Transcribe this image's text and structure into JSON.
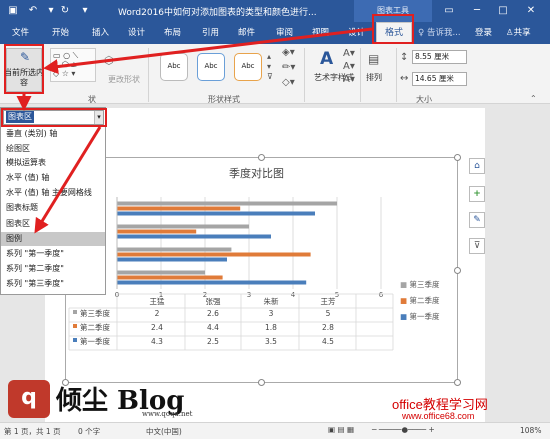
{
  "window": {
    "title": "Word2016中如何对添加图表的类型和颜色进行...",
    "context_tab": "图表工具",
    "user": "登录",
    "share": "共享",
    "tell_me": "告诉我..."
  },
  "tabs": [
    "文件",
    "开始",
    "插入",
    "设计",
    "布局",
    "引用",
    "邮件",
    "审阅",
    "视图",
    "设计",
    "格式"
  ],
  "ribbon": {
    "current_selection_label": "当前所选内容",
    "change_shape": "更改形状",
    "shape_style_label": "形状样式",
    "shapes_label": "状",
    "swatch_text": "Abc",
    "art_text": "艺术字样式",
    "arrange": "排列",
    "size_label": "大小",
    "height": "8.55 厘米",
    "width": "14.65 厘米"
  },
  "dropdown": {
    "selected": "图表区",
    "items": [
      "垂直 (类别) 轴",
      "绘图区",
      "模拟运算表",
      "水平 (值) 轴",
      "水平 (值) 轴 主要网格线",
      "图表标题",
      "图表区",
      "图例",
      "系列 \"第一季度\"",
      "系列 \"第二季度\"",
      "系列 \"第三季度\""
    ],
    "highlighted": "图例"
  },
  "chart_data": {
    "type": "bar",
    "title": "季度对比图",
    "categories": [
      "王猛",
      "张强",
      "朱新",
      "王芳"
    ],
    "series": [
      {
        "name": "第一季度",
        "values": [
          4.3,
          2.5,
          3.5,
          4.5
        ],
        "color": "#4a7ebb"
      },
      {
        "name": "第二季度",
        "values": [
          2.4,
          4.4,
          1.8,
          2.8
        ],
        "color": "#e07b39"
      },
      {
        "name": "第三季度",
        "values": [
          2,
          2.6,
          3,
          5
        ],
        "color": "#a5a5a5"
      }
    ],
    "xlim": [
      0,
      6
    ],
    "xticks": [
      "0",
      "1",
      "2",
      "3",
      "4",
      "5",
      "6"
    ],
    "legend": "right",
    "data_table": true
  },
  "status": {
    "page": "第 1 页，共 1 页",
    "words": "0 个字",
    "lang": "中文(中国)",
    "zoom": "108%"
  },
  "watermark": {
    "blog": "倾尘 Blog",
    "blog_url": "www.qoqa.net",
    "site": "office教程学习网",
    "site_url": "www.office68.com"
  },
  "colors": {
    "word_blue": "#2b579a",
    "annotation_red": "#e02020"
  }
}
